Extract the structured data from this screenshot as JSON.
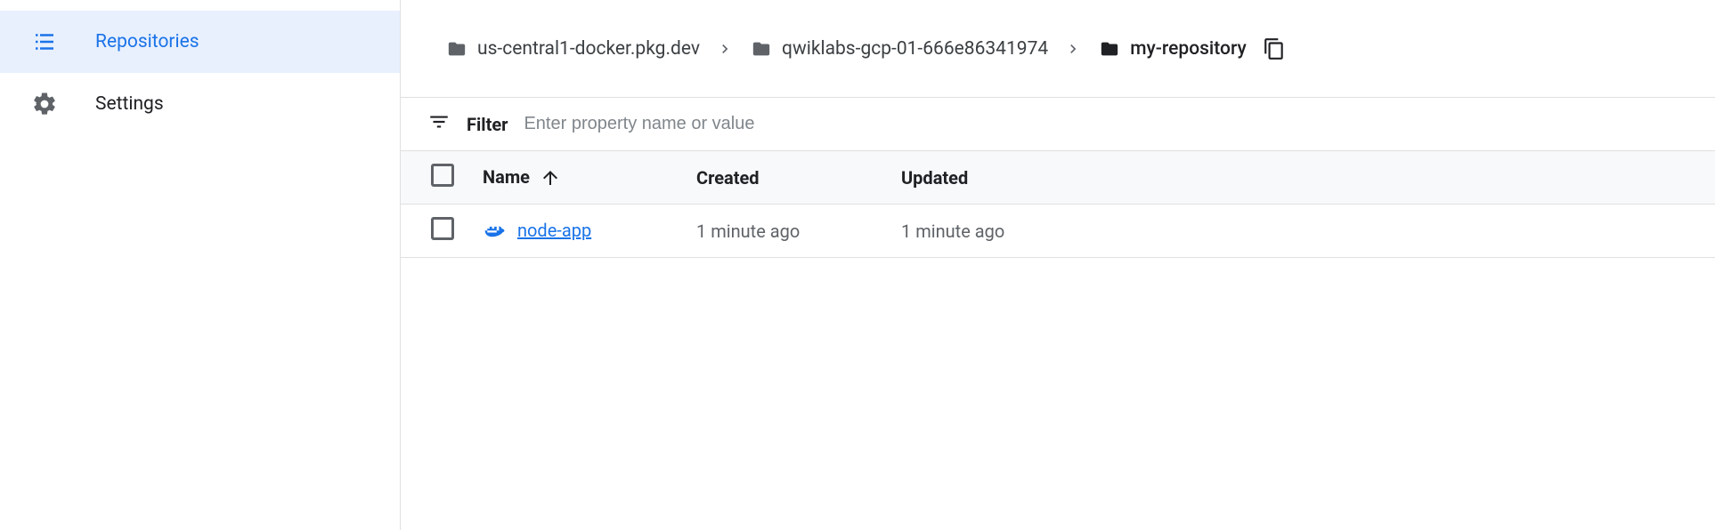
{
  "sidebar": {
    "items": [
      {
        "label": "Repositories"
      },
      {
        "label": "Settings"
      }
    ]
  },
  "breadcrumb": {
    "items": [
      {
        "label": "us-central1-docker.pkg.dev"
      },
      {
        "label": "qwiklabs-gcp-01-666e86341974"
      },
      {
        "label": "my-repository"
      }
    ]
  },
  "filter": {
    "label": "Filter",
    "placeholder": "Enter property name or value"
  },
  "table": {
    "columns": {
      "name": "Name",
      "created": "Created",
      "updated": "Updated"
    },
    "rows": [
      {
        "name": "node-app",
        "created": "1 minute ago",
        "updated": "1 minute ago"
      }
    ]
  }
}
